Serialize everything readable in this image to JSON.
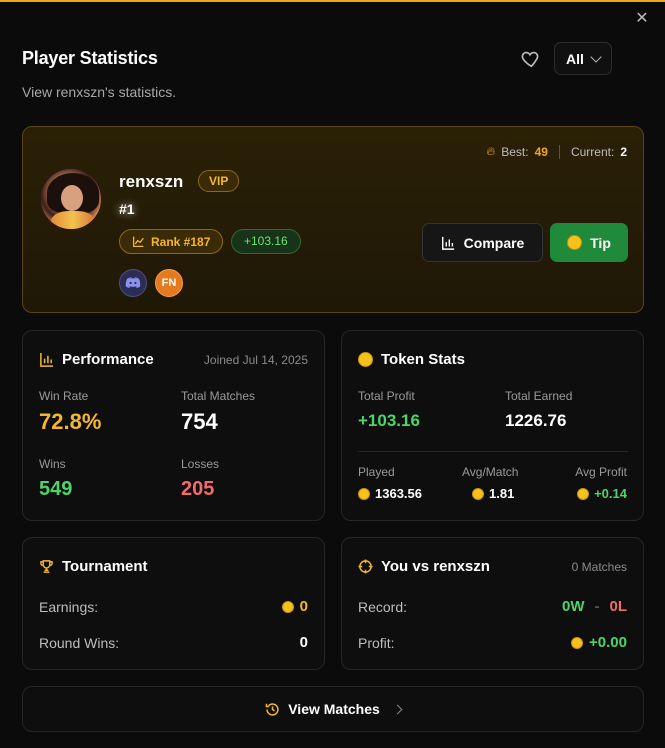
{
  "header": {
    "title": "Player Statistics",
    "subtitle": "View renxszn's statistics.",
    "filter_value": "All",
    "close_icon": "close-icon",
    "favorite_icon": "heart-icon"
  },
  "profile": {
    "username": "renxszn",
    "vip_label": "VIP",
    "position": "#1",
    "streak": {
      "best_label": "Best:",
      "best_value": "49",
      "current_label": "Current:",
      "current_value": "2"
    },
    "rank_label": "Rank #187",
    "profit_badge": "+103.16",
    "socials": [
      "discord-icon",
      "FN"
    ],
    "compare_label": "Compare",
    "tip_label": "Tip"
  },
  "performance": {
    "title": "Performance",
    "joined": "Joined Jul 14, 2025",
    "win_rate_label": "Win Rate",
    "win_rate_value": "72.8%",
    "total_matches_label": "Total Matches",
    "total_matches_value": "754",
    "wins_label": "Wins",
    "wins_value": "549",
    "losses_label": "Losses",
    "losses_value": "205"
  },
  "token_stats": {
    "title": "Token Stats",
    "total_profit_label": "Total Profit",
    "total_profit_value": "+103.16",
    "total_earned_label": "Total Earned",
    "total_earned_value": "1226.76",
    "played_label": "Played",
    "played_value": "1363.56",
    "avg_match_label": "Avg/Match",
    "avg_match_value": "1.81",
    "avg_profit_label": "Avg Profit",
    "avg_profit_value": "+0.14"
  },
  "tournament": {
    "title": "Tournament",
    "earnings_label": "Earnings:",
    "earnings_value": "0",
    "round_wins_label": "Round Wins:",
    "round_wins_value": "0"
  },
  "versus": {
    "title": "You vs renxszn",
    "matches": "0 Matches",
    "record_label": "Record:",
    "record_wins": "0W",
    "record_sep": "-",
    "record_losses": "0L",
    "profit_label": "Profit:",
    "profit_value": "+0.00"
  },
  "footer": {
    "view_matches_label": "View Matches"
  },
  "colors": {
    "accent": "#f5b82a",
    "positive": "#4ed46a",
    "negative": "#f26b6b",
    "tip_button": "#1f8a3a"
  }
}
